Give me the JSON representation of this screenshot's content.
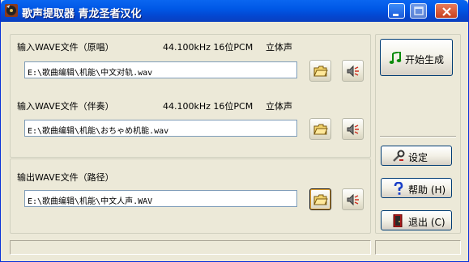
{
  "window": {
    "title": "歌声提取器 青龙圣者汉化",
    "app_icon": "record-icon",
    "controls": [
      "minimize-icon",
      "maximize-icon",
      "close-icon"
    ]
  },
  "original": {
    "label": "输入WAVE文件（原唱）",
    "rate": "44.100kHz 16位PCM",
    "channels": "立体声",
    "path": "E:\\歌曲编辑\\机能\\中文对轨.wav"
  },
  "accompaniment": {
    "label": "输入WAVE文件（伴奏）",
    "rate": "44.100kHz 16位PCM",
    "channels": "立体声",
    "path": "E:\\歌曲编辑\\机能\\おちゃめ机能.wav"
  },
  "output": {
    "label": "输出WAVE文件（路径）",
    "path": "E:\\歌曲编辑\\机能\\中文人声.WAV"
  },
  "buttons": {
    "generate": "开始生成",
    "settings": "设定",
    "help": "帮助 (H)",
    "exit": "退出 (C)"
  },
  "icons": {
    "browse": "folder-icon",
    "play": "speaker-icon",
    "generate": "music-note-icon",
    "settings": "tools-icon",
    "help": "question-icon",
    "exit": "exit-door-icon"
  },
  "colors": {
    "titlebar": "#0058E6",
    "face": "#ECE9D8",
    "input_border": "#7F9DB9"
  }
}
